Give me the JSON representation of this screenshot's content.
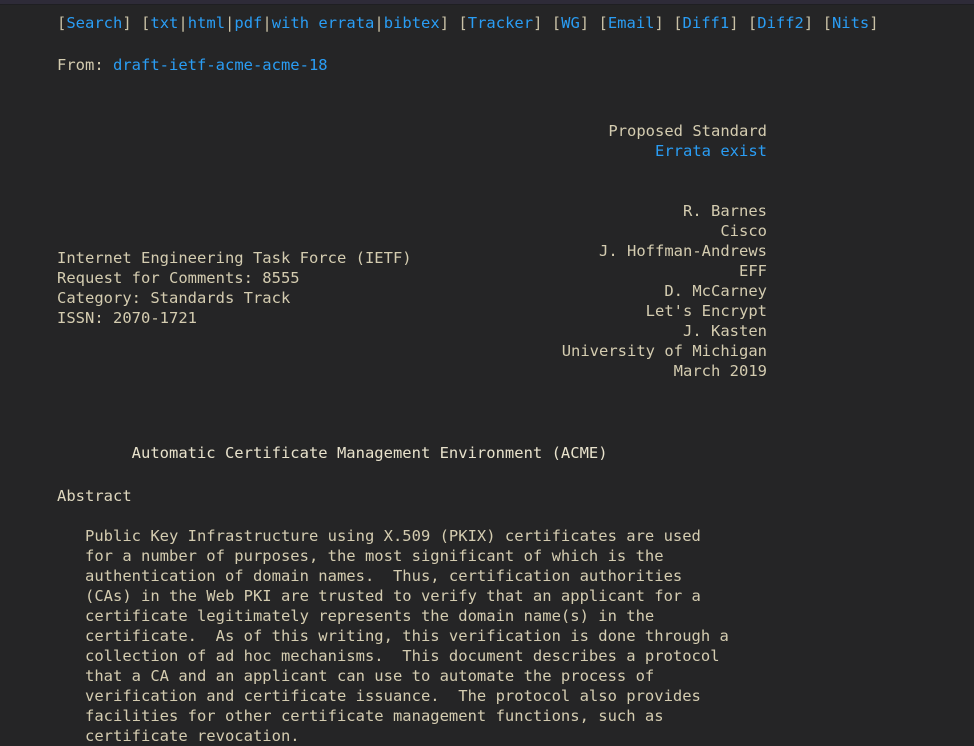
{
  "document": {
    "title_line": "        Automatic Certificate Management Environment (ACME)",
    "section_heading": "Abstract"
  },
  "toolbar": {
    "links": [
      {
        "label": "Search",
        "open": "[",
        "close": "]"
      },
      {
        "label": "txt"
      },
      {
        "label": "html"
      },
      {
        "label": "pdf"
      },
      {
        "label": "with errata"
      },
      {
        "label": "bibtex"
      },
      {
        "label": "Tracker"
      },
      {
        "label": "WG"
      },
      {
        "label": "Email"
      },
      {
        "label": "Diff1"
      },
      {
        "label": "Diff2"
      },
      {
        "label": "Nits"
      }
    ],
    "bracket_open": "[",
    "bracket_close": "]",
    "separator": "|",
    "space": " "
  },
  "from": {
    "label": "From: ",
    "draft": "draft-ietf-acme-acme-18"
  },
  "status": {
    "standard": "Proposed Standard",
    "errata": "Errata exist"
  },
  "header_left": [
    "Internet Engineering Task Force (IETF)",
    "Request for Comments: 8555",
    "Category: Standards Track",
    "ISSN: 2070-1721"
  ],
  "header_right": [
    "R. Barnes",
    "Cisco",
    "J. Hoffman-Andrews",
    "EFF",
    "D. McCarney",
    "Let's Encrypt",
    "J. Kasten",
    "University of Michigan",
    "March 2019"
  ],
  "abstract": {
    "lines": [
      "   Public Key Infrastructure using X.509 (PKIX) certificates are used",
      "   for a number of purposes, the most significant of which is the",
      "   authentication of domain names.  Thus, certification authorities",
      "   (CAs) in the Web PKI are trusted to verify that an applicant for a",
      "   certificate legitimately represents the domain name(s) in the",
      "   certificate.  As of this writing, this verification is done through a",
      "   collection of ad hoc mechanisms.  This document describes a protocol",
      "   that a CA and an applicant can use to automate the process of",
      "   verification and certificate issuance.  The protocol also provides",
      "   facilities for other certificate management functions, such as",
      "   certificate revocation."
    ]
  },
  "colors": {
    "background": "#252526",
    "text": "#d4ccb0",
    "link": "#2a9df4",
    "bracket": "#c9c1a6",
    "title": "#e8e2cc",
    "chrome": "#2e2b38"
  }
}
